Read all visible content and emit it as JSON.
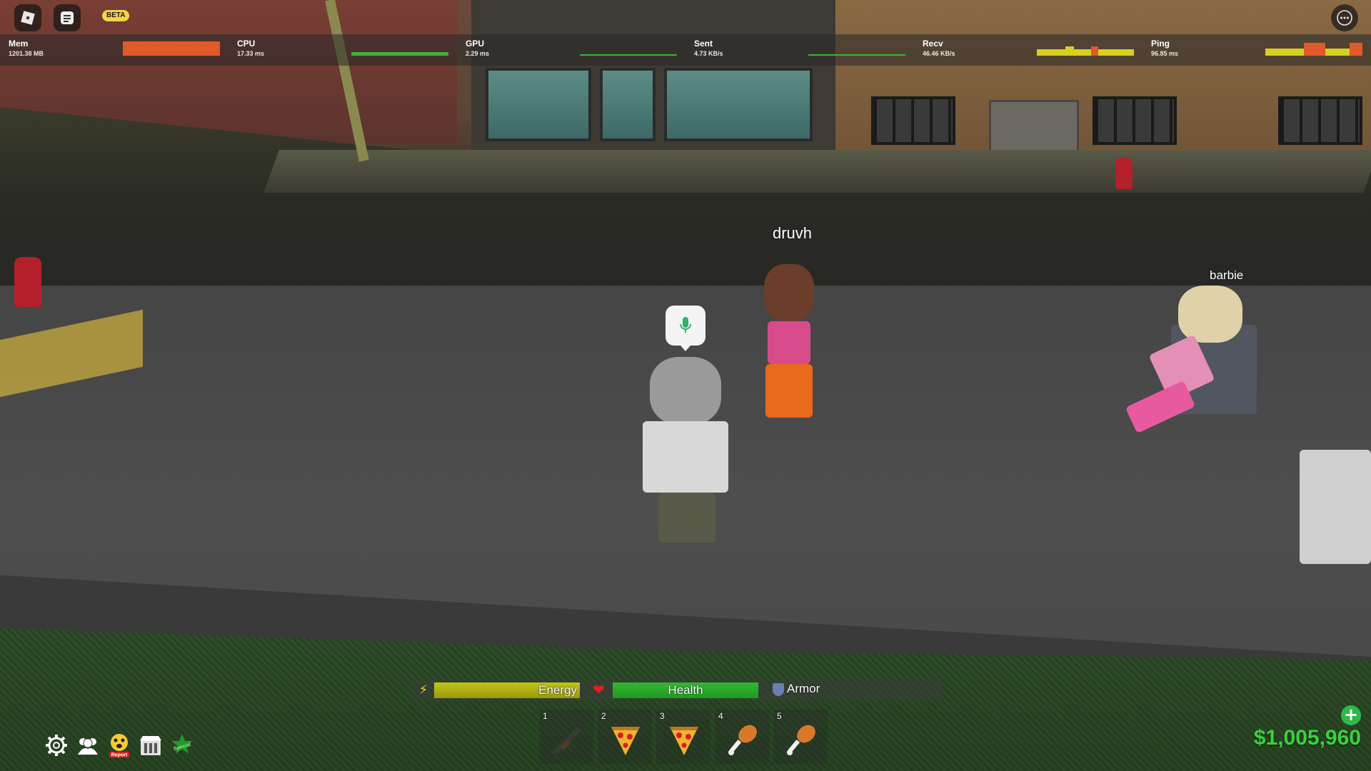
{
  "window": {
    "beta_badge": "BETA"
  },
  "stats": [
    {
      "name": "Mem",
      "value": "1201.38 MB",
      "graph_color": "#e05a2a"
    },
    {
      "name": "CPU",
      "value": "17.33 ms",
      "graph_color": "#3bb33b"
    },
    {
      "name": "GPU",
      "value": "2.29 ms",
      "graph_color": "#3bb33b"
    },
    {
      "name": "Sent",
      "value": "4.73 KB/s",
      "graph_color": "#3bb33b"
    },
    {
      "name": "Recv",
      "value": "46.46 KB/s",
      "graph_color": "#d6d020"
    },
    {
      "name": "Ping",
      "value": "96.85 ms",
      "graph_color": "#d6d020"
    }
  ],
  "players": {
    "near": {
      "name": "druvh"
    },
    "far": {
      "name": "barbie"
    }
  },
  "status": {
    "energy_label": "Energy",
    "energy_level": 1.0,
    "health_label": "Health",
    "health_level": 1.0,
    "armor_label": "Armor"
  },
  "hotbar": [
    {
      "number": "1",
      "item": "rifle-icon"
    },
    {
      "number": "2",
      "item": "pizza-icon"
    },
    {
      "number": "3",
      "item": "pizza-icon"
    },
    {
      "number": "4",
      "item": "chicken-leg-icon"
    },
    {
      "number": "5",
      "item": "chicken-leg-icon"
    }
  ],
  "side_menu": [
    {
      "icon": "settings-gear-icon"
    },
    {
      "icon": "friends-icon"
    },
    {
      "icon": "report-icon",
      "label": "Report"
    },
    {
      "icon": "shop-icon"
    },
    {
      "icon": "special-icon",
      "label": "Special"
    }
  ],
  "cash": {
    "amount": "$1,005,960",
    "color": "#3bd23b"
  },
  "colors": {
    "energy": "#c4c41a",
    "health": "#34b834",
    "cash": "#3bd23b"
  }
}
